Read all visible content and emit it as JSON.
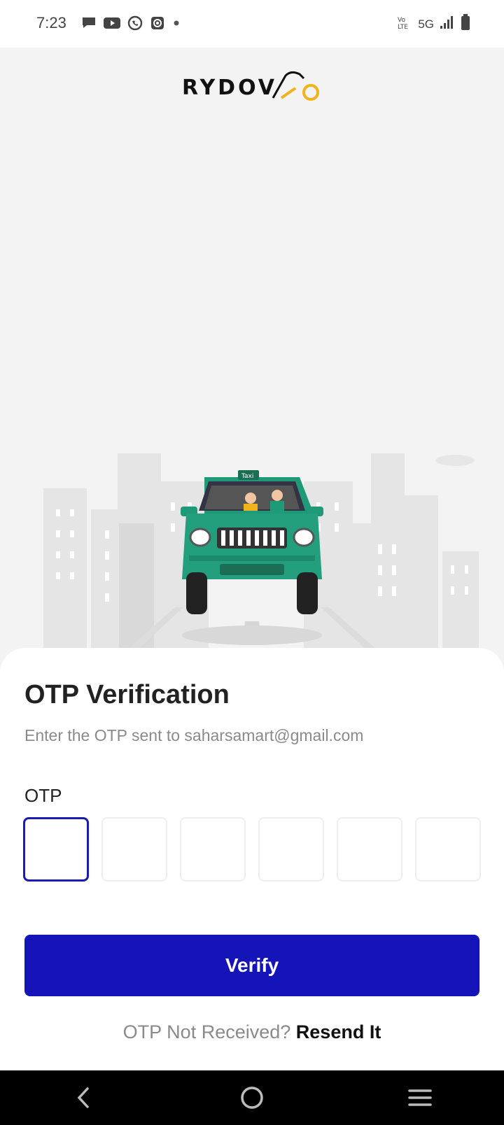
{
  "status_bar": {
    "time": "7:23",
    "network": "5G",
    "volte": "VoLTE",
    "notification_icons": [
      "message-icon",
      "youtube-icon",
      "whatsapp-icon",
      "screen-record-icon",
      "dot-icon"
    ]
  },
  "app": {
    "logo_text": "RYDOV",
    "brand_accent": "#f2b21b"
  },
  "illustration": {
    "taxi_sign": "Taxi"
  },
  "otp_sheet": {
    "title": "OTP Verification",
    "subtitle": "Enter the OTP sent to saharsamart@gmail.com",
    "otp_label": "OTP",
    "otp_digits": [
      "",
      "",
      "",
      "",
      "",
      ""
    ],
    "verify_label": "Verify",
    "resend_question": "OTP Not Received?",
    "resend_link": "Resend It"
  },
  "colors": {
    "primary": "#1414b8",
    "taxi_green": "#1f9a79"
  },
  "nav_bar": {
    "buttons": [
      "back-icon",
      "home-icon",
      "recents-icon"
    ]
  }
}
